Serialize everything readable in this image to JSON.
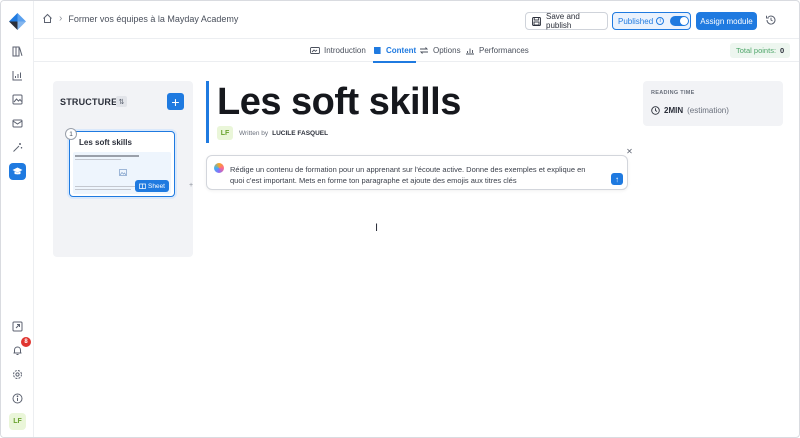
{
  "header": {
    "breadcrumb_title": "Former vos équipes à la Mayday Academy",
    "save_label": "Save and publish",
    "published_label": "Published",
    "assign_label": "Assign module"
  },
  "tabs": [
    {
      "label": "Introduction",
      "icon": "introduction-icon"
    },
    {
      "label": "Content",
      "icon": "book-icon",
      "active": true
    },
    {
      "label": "Options",
      "icon": "options-icon"
    },
    {
      "label": "Performances",
      "icon": "chart-icon"
    }
  ],
  "points": {
    "label": "Total points:",
    "value": "0"
  },
  "structure": {
    "title": "STRUCTURE",
    "item": {
      "number": "1",
      "title": "Les soft skills",
      "tag": "Sheet"
    }
  },
  "editor": {
    "title": "Les soft skills",
    "author_initials": "LF",
    "written_by": "Written by",
    "author_name": "LUCILE FASQUEL",
    "prompt_text": "Rédige un contenu de formation pour un apprenant sur l'écoute active. Donne des exemples et explique en quoi c'est important. Mets en forme ton paragraphe et ajoute des emojis aux titres clés"
  },
  "reading_time": {
    "label": "READING TIME",
    "value": "2MIN",
    "note": "(estimation)"
  },
  "rail": {
    "notification_count": "8",
    "user_initials": "LF"
  },
  "colors": {
    "accent": "#1f7ae0",
    "panel": "#f2f3f6",
    "danger": "#e0342f"
  }
}
